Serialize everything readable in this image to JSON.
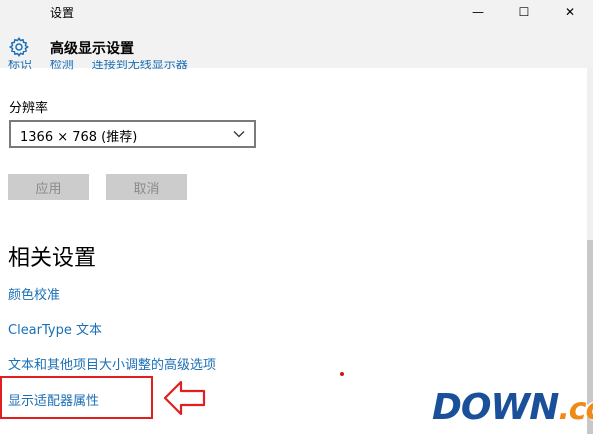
{
  "window": {
    "title": "设置",
    "minimize_glyph": "—",
    "maximize_glyph": "☐",
    "close_glyph": "✕"
  },
  "header": {
    "page_title": "高级显示设置",
    "icon": "gear-icon"
  },
  "top_links": [
    "标识",
    "检测",
    "连接到无线显示器"
  ],
  "resolution": {
    "label": "分辨率",
    "value": "1366 × 768 (推荐)"
  },
  "buttons": {
    "apply": "应用",
    "cancel": "取消"
  },
  "related": {
    "title": "相关设置",
    "links": [
      "颜色校准",
      "ClearType 文本",
      "文本和其他项目大小调整的高级选项",
      "显示适配器属性"
    ]
  },
  "watermark": {
    "main": "DOWN",
    "suffix": ".cc"
  },
  "colors": {
    "link": "#1a6fb5",
    "highlight": "#e02020",
    "titlebar": "#f2f2f2",
    "button_disabled": "#cccccc"
  }
}
